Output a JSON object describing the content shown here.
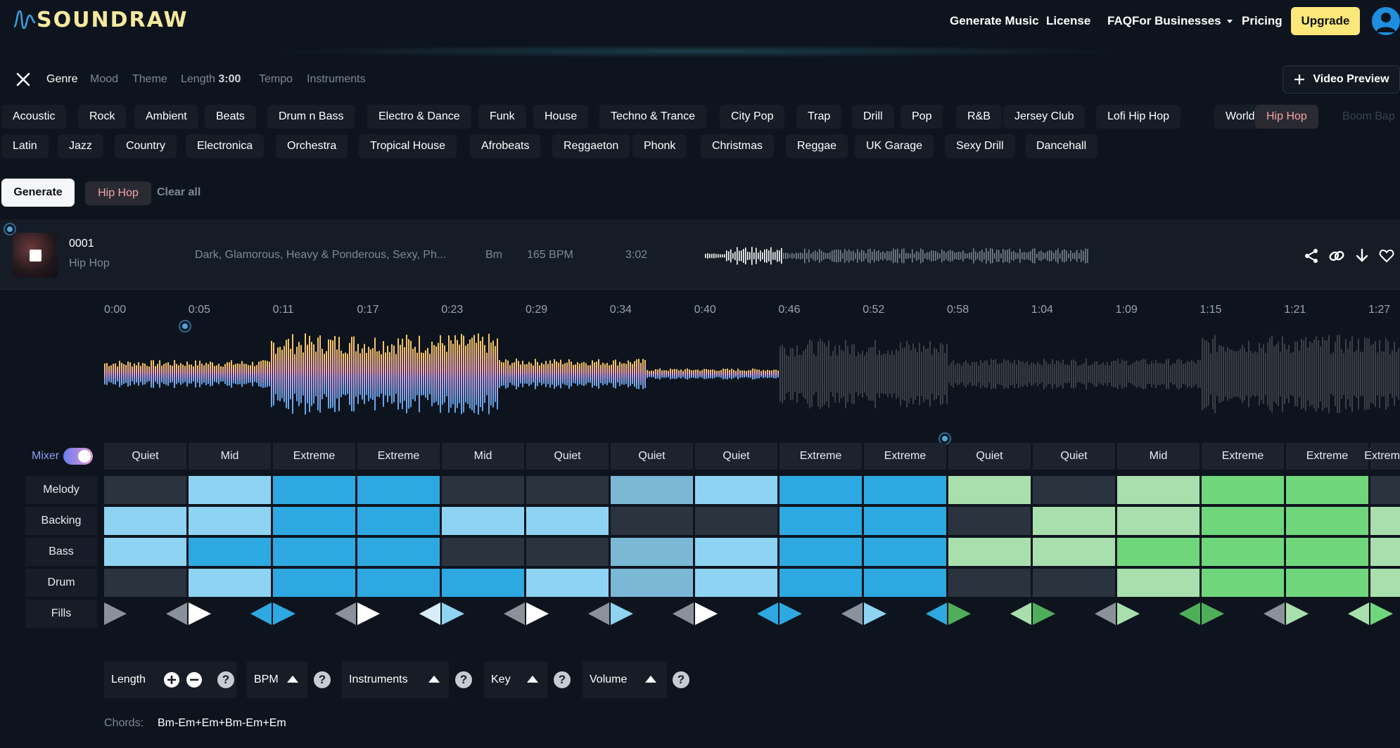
{
  "header": {
    "logo_text": "SOUNDRAW",
    "nav": [
      "Generate Music",
      "License",
      "FAQ",
      "For Businesses",
      "Pricing"
    ],
    "upgrade_label": "Upgrade"
  },
  "filters": {
    "tabs": [
      {
        "label": "Genre",
        "active": true
      },
      {
        "label": "Mood",
        "active": false
      },
      {
        "label": "Theme",
        "active": false
      },
      {
        "label": "Length",
        "active": false,
        "value": "3:00"
      },
      {
        "label": "Tempo",
        "active": false
      },
      {
        "label": "Instruments",
        "active": false
      }
    ],
    "video_preview_label": "Video Preview"
  },
  "genres_row1": [
    "Acoustic",
    "Rock",
    "Ambient",
    "Beats",
    "Drum n Bass",
    "Electro & Dance",
    "Funk",
    "House",
    "Techno & Trance",
    "City Pop",
    "Trap",
    "Drill",
    "Pop",
    "R&B",
    "Jersey Club",
    "Lofi Hip Hop",
    "World",
    "Hip Hop",
    "Boom Bap"
  ],
  "genres_row2": [
    "Latin",
    "Jazz",
    "Country",
    "Electronica",
    "Orchestra",
    "Tropical House",
    "Afrobeats",
    "Reggaeton",
    "Phonk",
    "Christmas",
    "Reggae",
    "UK Garage",
    "Sexy Drill",
    "Dancehall"
  ],
  "selected_genre": "Hip Hop",
  "actions": {
    "generate_label": "Generate",
    "active_tag": "Hip Hop",
    "clear_label": "Clear all"
  },
  "track": {
    "number": "0001",
    "genre": "Hip Hop",
    "moods": "Dark, Glamorous, Heavy & Ponderous, Sexy, Ph...",
    "key": "Bm",
    "bpm": "165 BPM",
    "duration": "3:02",
    "progress": 0.02,
    "icons": [
      "share-icon",
      "link-icon",
      "download-icon",
      "heart-icon"
    ]
  },
  "timeline": {
    "ticks": [
      "0:00",
      "0:05",
      "0:11",
      "0:17",
      "0:23",
      "0:29",
      "0:34",
      "0:40",
      "0:46",
      "0:52",
      "0:58",
      "1:04",
      "1:09",
      "1:15",
      "1:21",
      "1:27"
    ],
    "played_fraction": 0.42
  },
  "mixer": {
    "label": "Mixer",
    "enabled": true,
    "intensity": [
      "Quiet",
      "Mid",
      "Extreme",
      "Extreme",
      "Mid",
      "Quiet",
      "Quiet",
      "Quiet",
      "Extreme",
      "Extreme",
      "Quiet",
      "Quiet",
      "Mid",
      "Extreme",
      "Extreme",
      "Extreme"
    ],
    "rows": [
      "Melody",
      "Backing",
      "Bass",
      "Drum",
      "Fills"
    ],
    "levels": {
      "Melody": [
        0,
        1,
        3,
        3,
        0,
        0,
        2,
        1,
        3,
        3,
        1,
        0,
        1,
        3,
        3,
        0
      ],
      "Backing": [
        1,
        1,
        3,
        3,
        1,
        1,
        0,
        0,
        3,
        3,
        0,
        1,
        1,
        3,
        3,
        1
      ],
      "Bass": [
        1,
        3,
        3,
        3,
        0,
        0,
        2,
        1,
        3,
        3,
        1,
        1,
        3,
        3,
        3,
        1
      ],
      "Drum": [
        0,
        1,
        3,
        3,
        3,
        1,
        2,
        1,
        3,
        3,
        0,
        0,
        1,
        3,
        3,
        1
      ]
    },
    "green_from_section": 10,
    "colors": {
      "off": "#2b333e",
      "blue_light": "#8fd3f2",
      "blue_mid": "#7ab8d6",
      "blue_strong": "#2ea8e0",
      "green_light": "#a8dfac",
      "green_strong": "#6fd67c"
    }
  },
  "controls": [
    {
      "label": "Length"
    },
    {
      "label": "BPM"
    },
    {
      "label": "Instruments"
    },
    {
      "label": "Key"
    },
    {
      "label": "Volume"
    }
  ],
  "chords": {
    "label": "Chords:",
    "value": "Bm-Em+Em+Bm-Em+Em"
  }
}
